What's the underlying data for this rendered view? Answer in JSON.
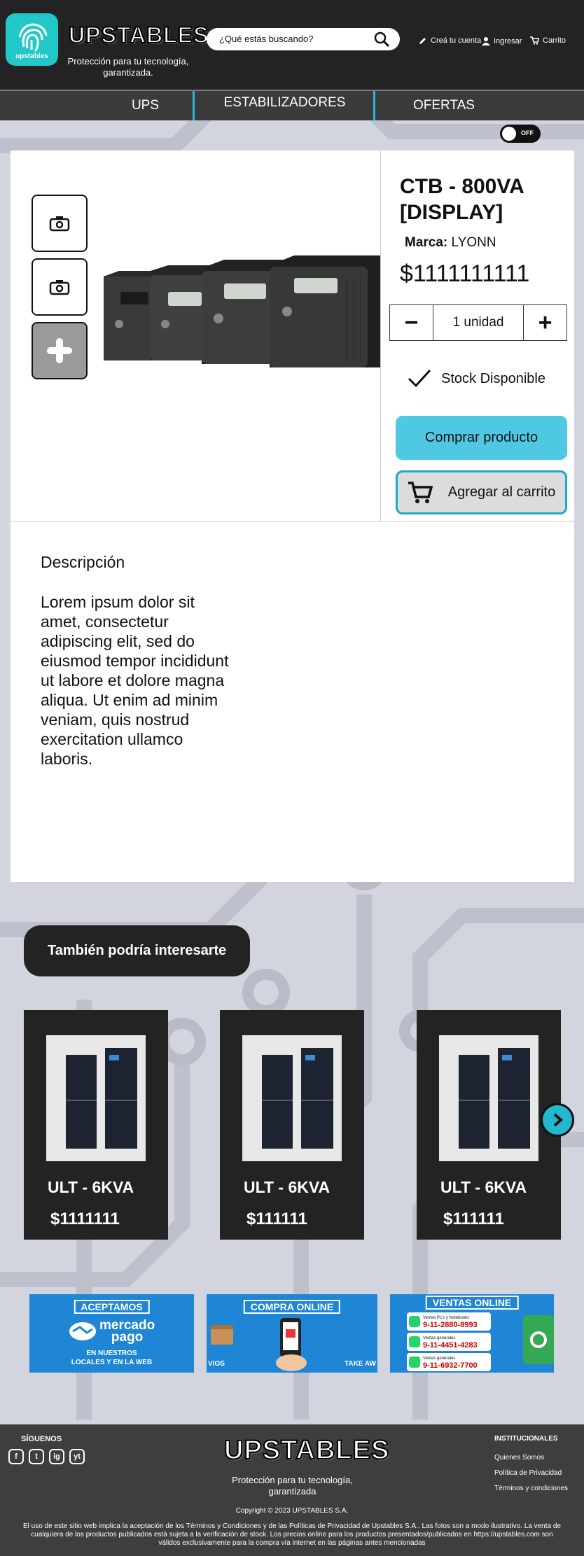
{
  "header": {
    "logo_text": "upstables",
    "brand": "UPSTABLES",
    "tagline": "Protección para tu tecnología, garantizada.",
    "search_placeholder": "¿Qué estás buscando?",
    "create_account": "Creá tu cuenta",
    "login": "Ingresar",
    "cart": "Carrito"
  },
  "nav": {
    "items": [
      "UPS",
      "ESTABILIZADORES",
      "OFERTAS"
    ]
  },
  "toggle": {
    "label": "OFF"
  },
  "product": {
    "title": "CTB - 800VA [DISPLAY]",
    "brand_label": "Marca:",
    "brand_value": "LYONN",
    "price": "$1111111111",
    "quantity": "1 unidad",
    "qty_minus": "−",
    "qty_plus": "+",
    "stock": "Stock Disponible",
    "buy_label": "Comprar producto",
    "add_cart_label": "Agregar al carrito",
    "description_title": "Descripción",
    "description": "Lorem ipsum dolor sit amet, consectetur adipiscing elit, sed do eiusmod tempor incididunt ut labore et dolore magna aliqua. Ut enim ad minim veniam, quis nostrud exercitation ullamco laboris."
  },
  "related": {
    "title": "También podría interesarte",
    "items": [
      {
        "name": "ULT - 6KVA",
        "price": "$1111111"
      },
      {
        "name": "ULT - 6KVA",
        "price": "$111111"
      },
      {
        "name": "ULT - 6KVA",
        "price": "$111111"
      }
    ]
  },
  "banners": [
    {
      "title": "ACEPTAMOS",
      "line1": "mercado",
      "line2": "pago",
      "line3": "EN NUESTROS",
      "line4": "LOCALES Y EN LA WEB"
    },
    {
      "title": "COMPRA ONLINE",
      "left": "VIOS",
      "right": "TAKE AW"
    },
    {
      "title": "VENTAS ONLINE",
      "rows": [
        {
          "label": "Ventas Pc's y Notebooks",
          "phone": "9-11-2880-8993"
        },
        {
          "label": "Ventas generales",
          "phone": "9-11-4451-4283"
        },
        {
          "label": "Ventas generales",
          "phone": "9-11-6932-7700"
        }
      ]
    }
  ],
  "footer": {
    "follow": "SÍGUENOS",
    "social": [
      "f",
      "t",
      "ig",
      "yt"
    ],
    "brand": "UPSTABLES",
    "tagline": "Protección para tu tecnología, garantizada",
    "copyright": "Copyright © 2023 UPSTABLES S.A.",
    "institutional_title": "INSTITUCIONALES",
    "links": [
      "Quienes Somos",
      "Política de Privacidad",
      "Términos y condiciones"
    ],
    "legal": "El uso de este sitio web implica la aceptación de los Términos y Condiciones y de las Políticas de Privacidad de Upstables S.A.. Las fotos son a modo ilustrativo. La venta de cualquiera de los productos publicados está sujeta a la verificación de stock. Los precios online para los productos presentados/publicados en https://upstables.com son válidos exclusivamente para la compra vía internet en las páginas antes mencionadas"
  },
  "colors": {
    "accent": "#4fc9e3",
    "nav_border": "#2bb7d4",
    "dark": "#232323",
    "bg": "#d3d5de"
  }
}
